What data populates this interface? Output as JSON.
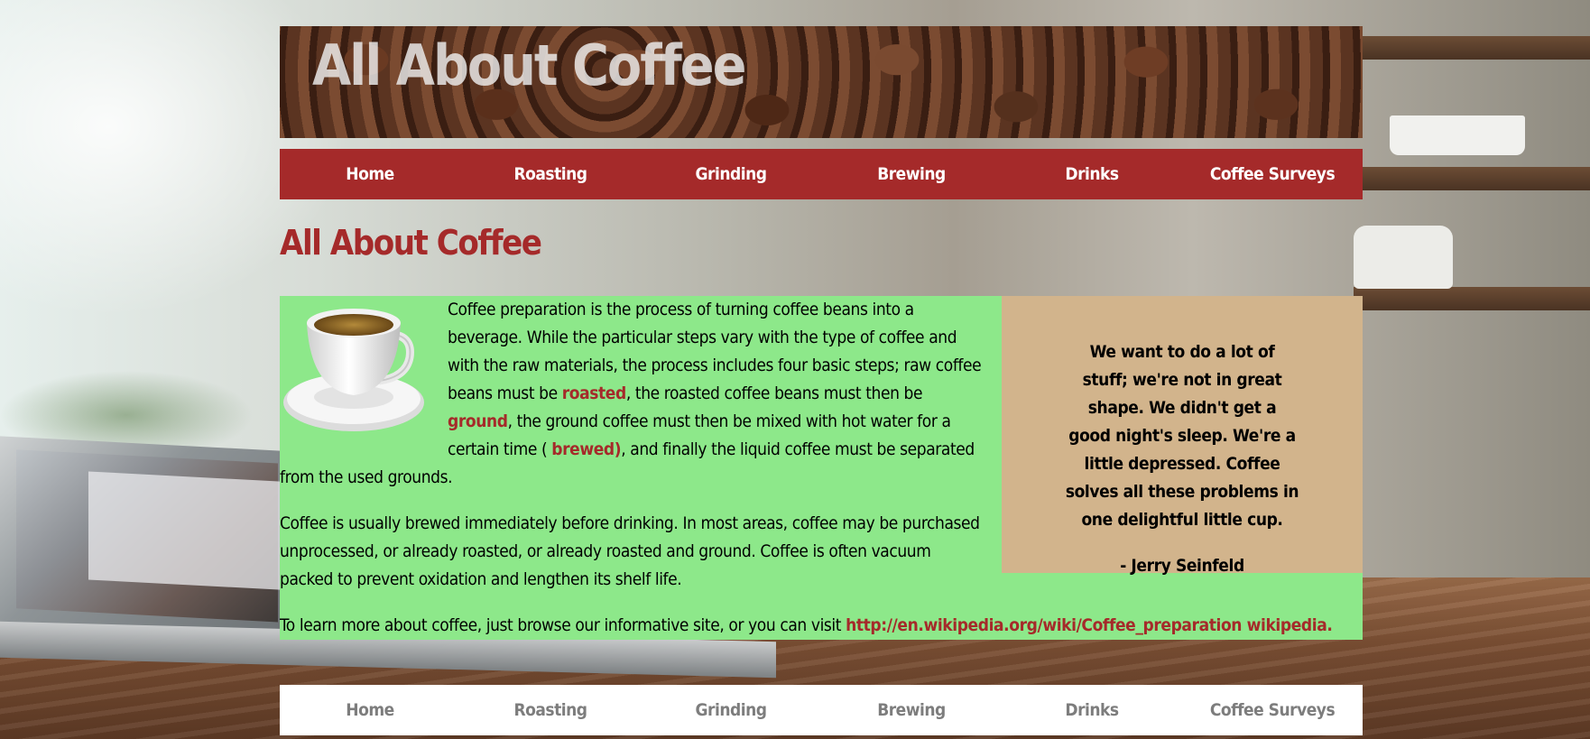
{
  "site": {
    "title": "All About Coffee"
  },
  "nav": [
    "Home",
    "Roasting",
    "Grinding",
    "Brewing",
    "Drinks",
    "Coffee Surveys"
  ],
  "page": {
    "heading": "All About Coffee"
  },
  "content": {
    "p1": {
      "t1": "Coffee preparation is the process of turning coffee beans into a beverage. While the particular steps vary with the type of coffee and with the raw materials, the process includes four basic steps; raw coffee beans must be ",
      "link_roasted": "roasted",
      "t2": ", the roasted coffee beans must then be ",
      "link_ground": "ground",
      "t3": ", the ground coffee must then be mixed with hot water for a certain time ( ",
      "link_brewed": "brewed)",
      "t4": ", and finally the liquid coffee must be separated from the used grounds."
    },
    "p2": "Coffee is usually brewed immediately before drinking. In most areas, coffee may be purchased unprocessed, or already roasted, or already roasted and ground. Coffee is often vacuum packed to prevent oxidation and lengthen its shelf life.",
    "p3": {
      "text": "To learn more about coffee, just browse our informative site, or you can visit ",
      "link": "http://en.wikipedia.org/wiki/Coffee_preparation wikipedia."
    }
  },
  "quote": {
    "text": "We want to do a lot of stuff; we're not in great shape. We didn't get a good night's sleep. We're a little depressed. Coffee solves all these problems in one delightful little cup.",
    "author": "- Jerry Seinfeld"
  },
  "colors": {
    "accent": "#a52a2a",
    "main_bg": "#8de88a",
    "quote_bg": "#d2b48c",
    "footer_nav_text": "#7d7d7d"
  },
  "icons": {
    "cup": "coffee-cup-icon"
  }
}
